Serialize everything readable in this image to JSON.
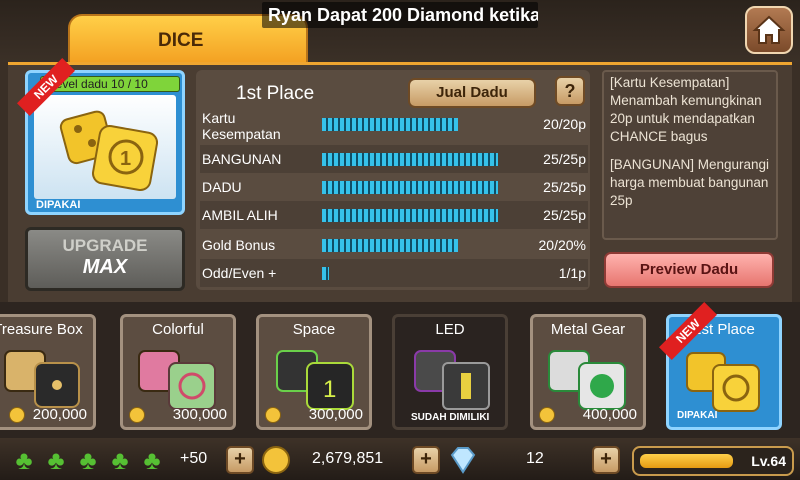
{
  "header": {
    "ticker": "Ryan Dapat 200 Diamond ketika",
    "tab": "DICE"
  },
  "selected": {
    "level_text": "Level dadu 10 / 10",
    "badge": "NEW",
    "status": "DIPAKAI",
    "upgrade_top": "UPGRADE",
    "upgrade_bottom": "MAX"
  },
  "stats": {
    "name": "1st Place",
    "sell_label": "Jual Dadu",
    "help_label": "?",
    "rows": [
      {
        "label": "Kartu Kesempatan",
        "value": "20/20p",
        "fill": 0.62
      },
      {
        "label": "BANGUNAN",
        "value": "25/25p",
        "fill": 0.8
      },
      {
        "label": "DADU",
        "value": "25/25p",
        "fill": 0.8
      },
      {
        "label": "AMBIL ALIH",
        "value": "25/25p",
        "fill": 0.8
      },
      {
        "label": "Gold Bonus",
        "value": "20/20%",
        "fill": 0.62
      },
      {
        "label": "Odd/Even +",
        "value": "1/1p",
        "fill": 0.03
      }
    ]
  },
  "info": {
    "p1": "[Kartu Kesempatan] Menambah kemungkinan 20p untuk mendapatkan CHANCE bagus",
    "p2": "[BANGUNAN] Mengurangi harga membuat bangunan 25p",
    "preview_label": "Preview Dadu"
  },
  "shelf": [
    {
      "name": "Treasure Box",
      "price": "200,000"
    },
    {
      "name": "Colorful",
      "price": "300,000"
    },
    {
      "name": "Space",
      "price": "300,000"
    },
    {
      "name": "LED",
      "status": "SUDAH DIMILIKI"
    },
    {
      "name": "Metal Gear",
      "price": "400,000"
    },
    {
      "name": "1st Place",
      "status": "DIPAKAI",
      "badge": "NEW"
    }
  ],
  "bottom": {
    "clover_bonus": "+50",
    "gold": "2,679,851",
    "diamonds": "12",
    "level": "Lv.64",
    "level_progress": 0.62
  },
  "colors": {
    "accent": "#f3a021",
    "selected_blue": "#2e8fd2",
    "stat_bar": "#36c2ea"
  },
  "icons": [
    "home-icon",
    "clover-icon",
    "gold-coin-icon",
    "diamond-icon"
  ]
}
